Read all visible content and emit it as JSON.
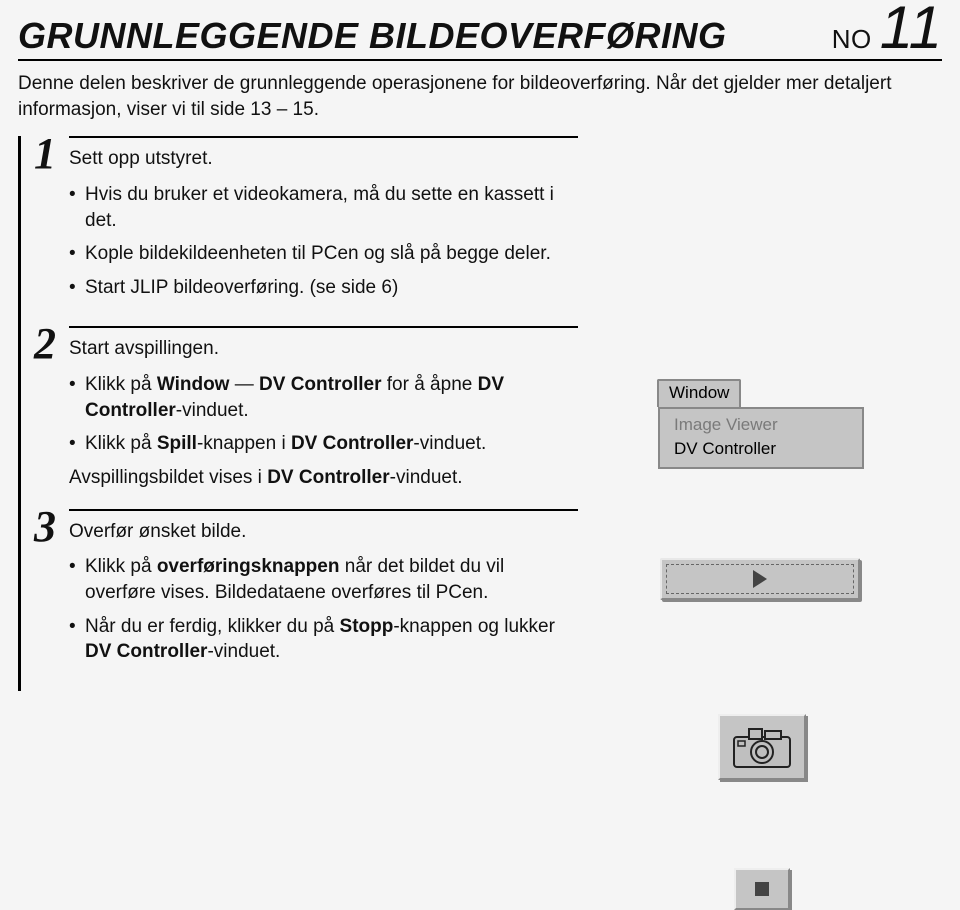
{
  "header": {
    "title": "GRUNNLEGGENDE BILDEOVERFØRING",
    "lang": "NO",
    "page": "11"
  },
  "intro": "Denne delen beskriver de grunnleggende operasjonene for bildeoverføring. Når det gjelder mer detaljert informasjon, viser vi til side 13 – 15.",
  "steps": [
    {
      "num": "1",
      "lead": "Sett opp utstyret.",
      "bullets": [
        {
          "pre": "Hvis du bruker et videokamera, må du sette en kassett i det."
        },
        {
          "pre": "Kople bildekildeenheten til PCen og slå på begge deler."
        },
        {
          "pre": "Start JLIP bildeoverføring. (se side 6)"
        }
      ],
      "trailer": ""
    },
    {
      "num": "2",
      "lead": "Start avspillingen.",
      "bullets": [
        {
          "html": "Klikk på <span class='b'>Window</span> — <span class='b'>DV Controller</span> for å åpne <span class='b'>DV Controller</span>-vinduet."
        },
        {
          "html": "Klikk på <span class='b'>Spill</span>-knappen i <span class='b'>DV Controller</span>-vinduet."
        }
      ],
      "trailer_html": "Avspillingsbildet vises i <span class='b'>DV Controller</span>-vinduet."
    },
    {
      "num": "3",
      "lead": "Overfør ønsket bilde.",
      "bullets": [
        {
          "html": "Klikk på <span class='b'>overføringsknappen</span> når det bildet du vil overføre vises. Bildedataene overføres til PCen."
        },
        {
          "html": "Når du er ferdig, klikker du på <span class='b'>Stopp</span>-knappen og lukker <span class='b'>DV Controller</span>-vinduet."
        }
      ],
      "trailer": ""
    }
  ],
  "window_menu": {
    "title": "Window",
    "items": [
      {
        "label": "Image Viewer",
        "disabled": true
      },
      {
        "label": "DV Controller",
        "disabled": false
      }
    ]
  },
  "icon_labels": {
    "play": "play-icon",
    "camera": "camera-icon",
    "stop": "stop-icon"
  }
}
